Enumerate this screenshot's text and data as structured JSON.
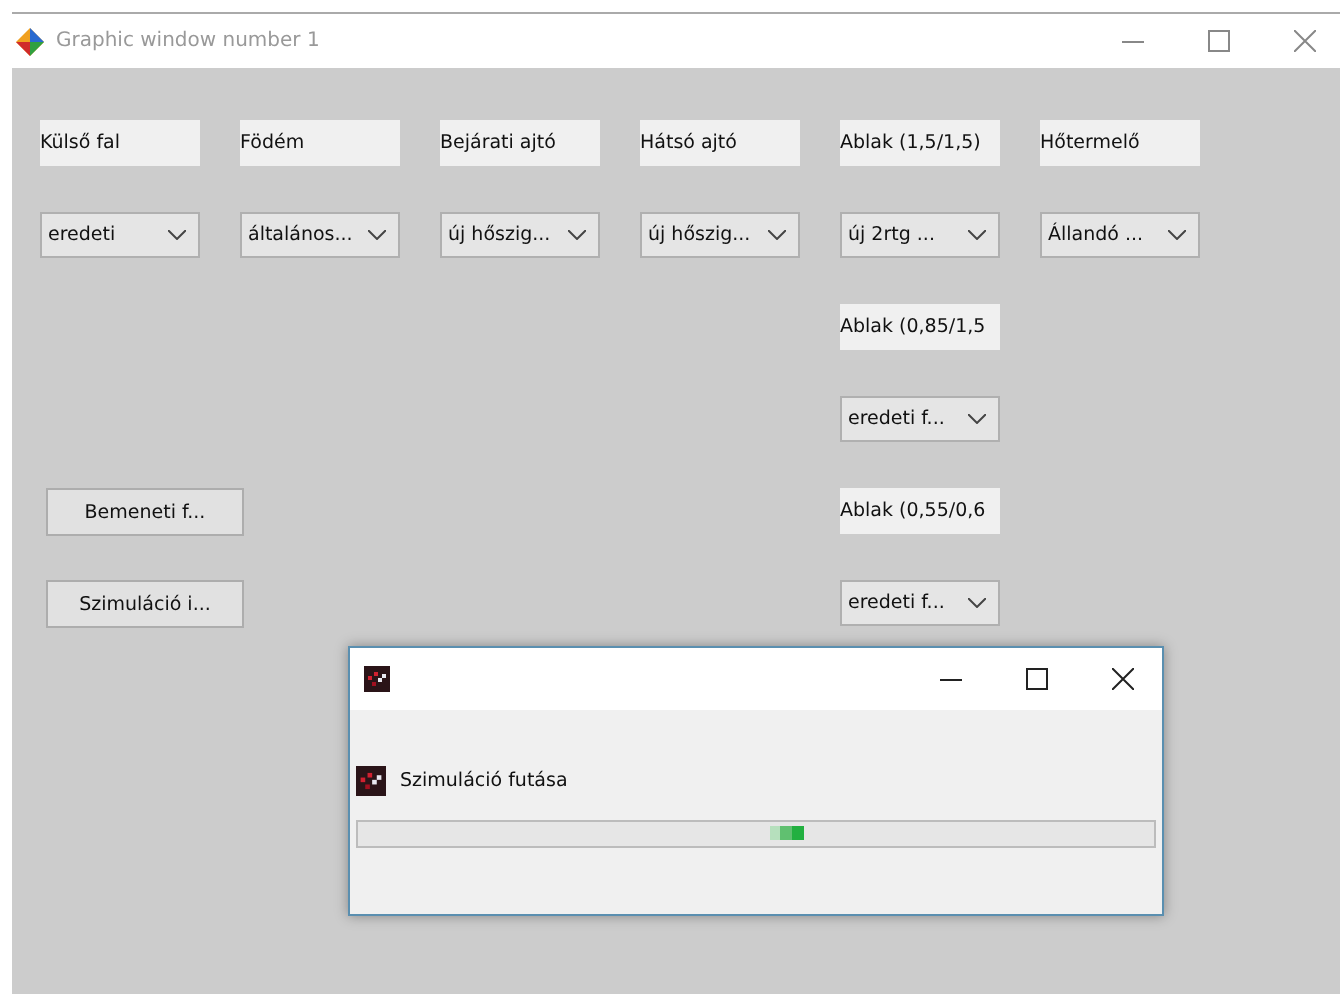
{
  "window": {
    "title": "Graphic window number 1"
  },
  "columns": [
    {
      "label": "Külső fal",
      "value": "eredeti"
    },
    {
      "label": "Födém",
      "value": "általános..."
    },
    {
      "label": "Bejárati ajtó",
      "value": "új hőszig..."
    },
    {
      "label": "Hátsó ajtó",
      "value": "új hőszig..."
    },
    {
      "label": "Ablak (1,5/1,5)",
      "value": "új 2rtg ..."
    },
    {
      "label": "Hőtermelő",
      "value": "Állandó ..."
    }
  ],
  "extra_fields": [
    {
      "label": "Ablak (0,85/1,5",
      "value": "eredeti f..."
    },
    {
      "label": "Ablak (0,55/0,6",
      "value": "eredeti f..."
    }
  ],
  "buttons": [
    "Bemeneti f...",
    "Szimuláció i..."
  ],
  "dialog": {
    "message": "Szimuláció futása",
    "progress": {
      "indeterminate": true
    }
  }
}
